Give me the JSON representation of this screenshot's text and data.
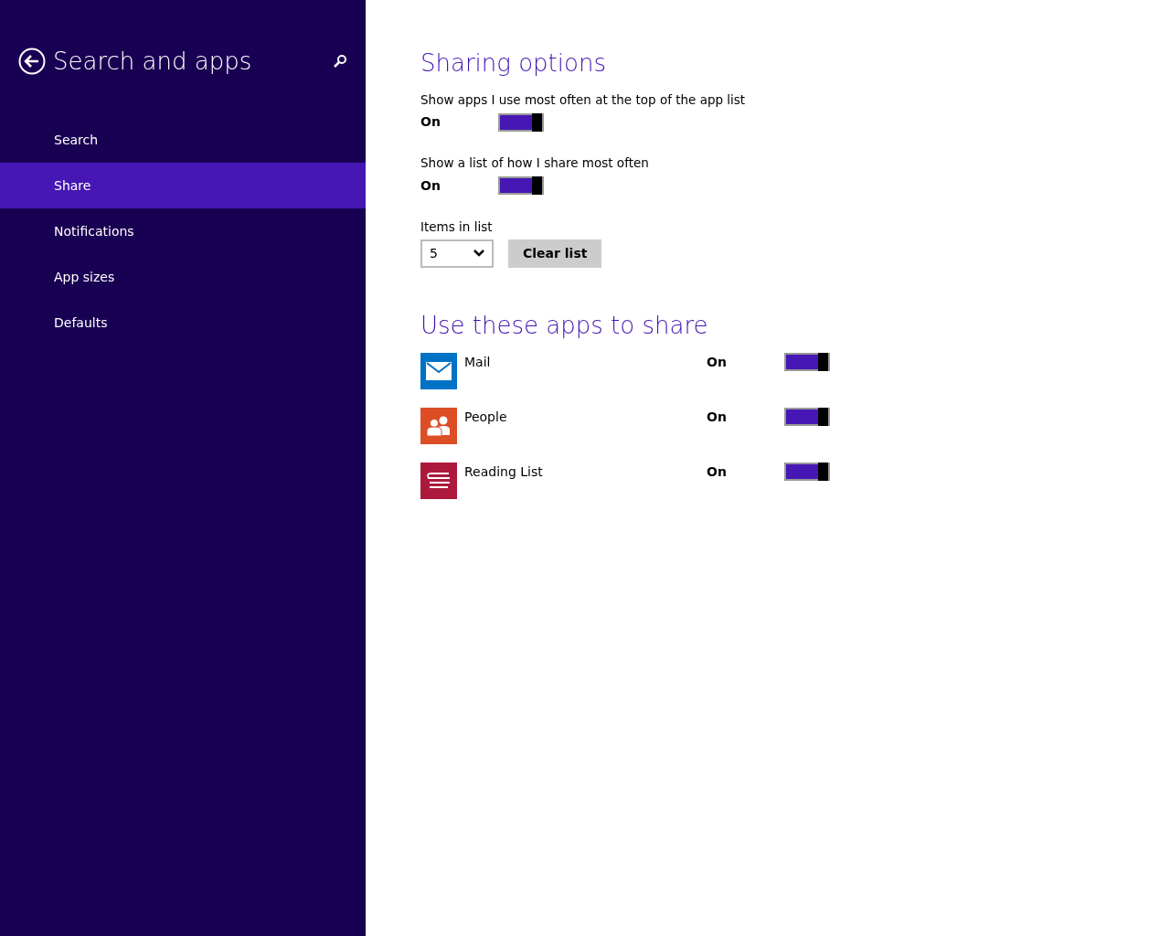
{
  "sidebar": {
    "title": "Search and apps",
    "items": [
      {
        "label": "Search",
        "selected": false
      },
      {
        "label": "Share",
        "selected": true
      },
      {
        "label": "Notifications",
        "selected": false
      },
      {
        "label": "App sizes",
        "selected": false
      },
      {
        "label": "Defaults",
        "selected": false
      }
    ]
  },
  "sharing_options": {
    "heading": "Sharing options",
    "toggles": [
      {
        "label": "Show apps I use most often at the top of the app list",
        "state": "On",
        "on": true
      },
      {
        "label": "Show a list of how I share most often",
        "state": "On",
        "on": true
      }
    ],
    "items_in_list": {
      "label": "Items in list",
      "value": "5",
      "button": "Clear list"
    }
  },
  "share_apps": {
    "heading": "Use these apps to share",
    "apps": [
      {
        "name": "Mail",
        "kind": "mail",
        "color": "#0072c6",
        "state": "On",
        "on": true
      },
      {
        "name": "People",
        "kind": "people",
        "color": "#dc4e26",
        "state": "On",
        "on": true
      },
      {
        "name": "Reading List",
        "kind": "reading",
        "color": "#ac193d",
        "state": "On",
        "on": true
      }
    ]
  }
}
